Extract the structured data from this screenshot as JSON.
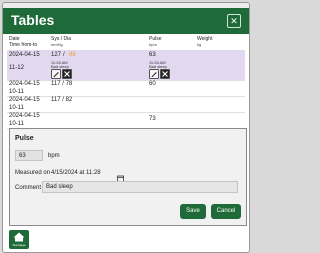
{
  "app": {
    "title": "Tables",
    "close_glyph": "✕"
  },
  "table": {
    "headers": {
      "date": "Date",
      "time": "Time from-to",
      "sysdia": "Sys / Dia",
      "sysdia_unit": "mmHg",
      "pulse": "Pulse",
      "pulse_unit": "bpm",
      "weight": "Weight",
      "weight_unit": "kg"
    },
    "rows": [
      {
        "date": "2024-04-15",
        "time": "11-12",
        "sys": "127",
        "sep": "/",
        "dia": "88",
        "sys_time": "11:28 AM",
        "sys_note": "Bad sleep",
        "pulse": "63",
        "pulse_time": "11:28 AM",
        "pulse_note": "Bad sleep",
        "selected": true
      },
      {
        "date": "2024-04-15",
        "time": "10-11",
        "sysdia": "117 / 78",
        "pulse": "60"
      },
      {
        "date": "2024-04-15",
        "time": "10-11",
        "sysdia": "117 / 82",
        "pulse": ""
      },
      {
        "date": "2024-04-15",
        "time": "10-11",
        "sysdia": "",
        "pulse": "73"
      }
    ]
  },
  "edit_panel": {
    "heading": "Pulse",
    "value": "63",
    "unit": "bpm",
    "measured_label": "Measured on",
    "measured_value": "4/15/2024 at 11:28",
    "comment_label": "Comment",
    "comment_value": "Bad sleep",
    "save_label": "Save",
    "cancel_label": "Cancel"
  },
  "home": {
    "label": "Startpage"
  },
  "colors": {
    "accent": "#1e6a38",
    "selected_row": "#e2d8ef",
    "dia_highlight": "#e8a23a"
  }
}
